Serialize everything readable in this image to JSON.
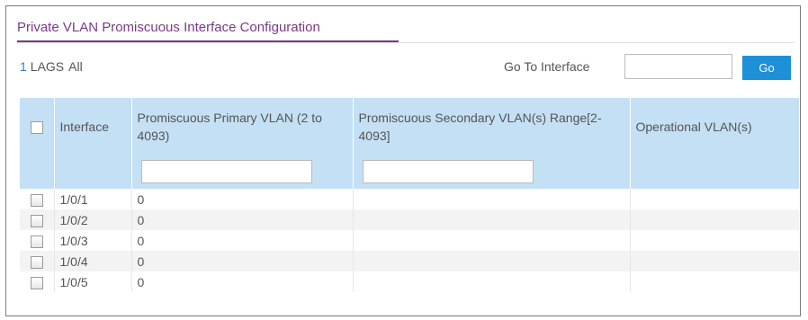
{
  "section_title": "Private VLAN Promiscuous Interface Configuration",
  "filters": {
    "count": "1",
    "items": [
      "LAGS",
      "All"
    ]
  },
  "goto": {
    "label": "Go To Interface",
    "value": "",
    "button": "Go"
  },
  "table": {
    "headers": [
      "Interface",
      "Promiscuous Primary VLAN (2 to 4093)",
      "Promiscuous Secondary VLAN(s) Range[2-4093]",
      "Operational VLAN(s)"
    ],
    "rows": [
      {
        "interface": "1/0/1",
        "primary": "0",
        "secondary": "",
        "operational": ""
      },
      {
        "interface": "1/0/2",
        "primary": "0",
        "secondary": "",
        "operational": ""
      },
      {
        "interface": "1/0/3",
        "primary": "0",
        "secondary": "",
        "operational": ""
      },
      {
        "interface": "1/0/4",
        "primary": "0",
        "secondary": "",
        "operational": ""
      },
      {
        "interface": "1/0/5",
        "primary": "0",
        "secondary": "",
        "operational": ""
      }
    ]
  },
  "colors": {
    "accent": "#7a3a86",
    "header_bg": "#c4e0f4",
    "button_bg": "#1e90d8",
    "link": "#3a7bbf"
  }
}
